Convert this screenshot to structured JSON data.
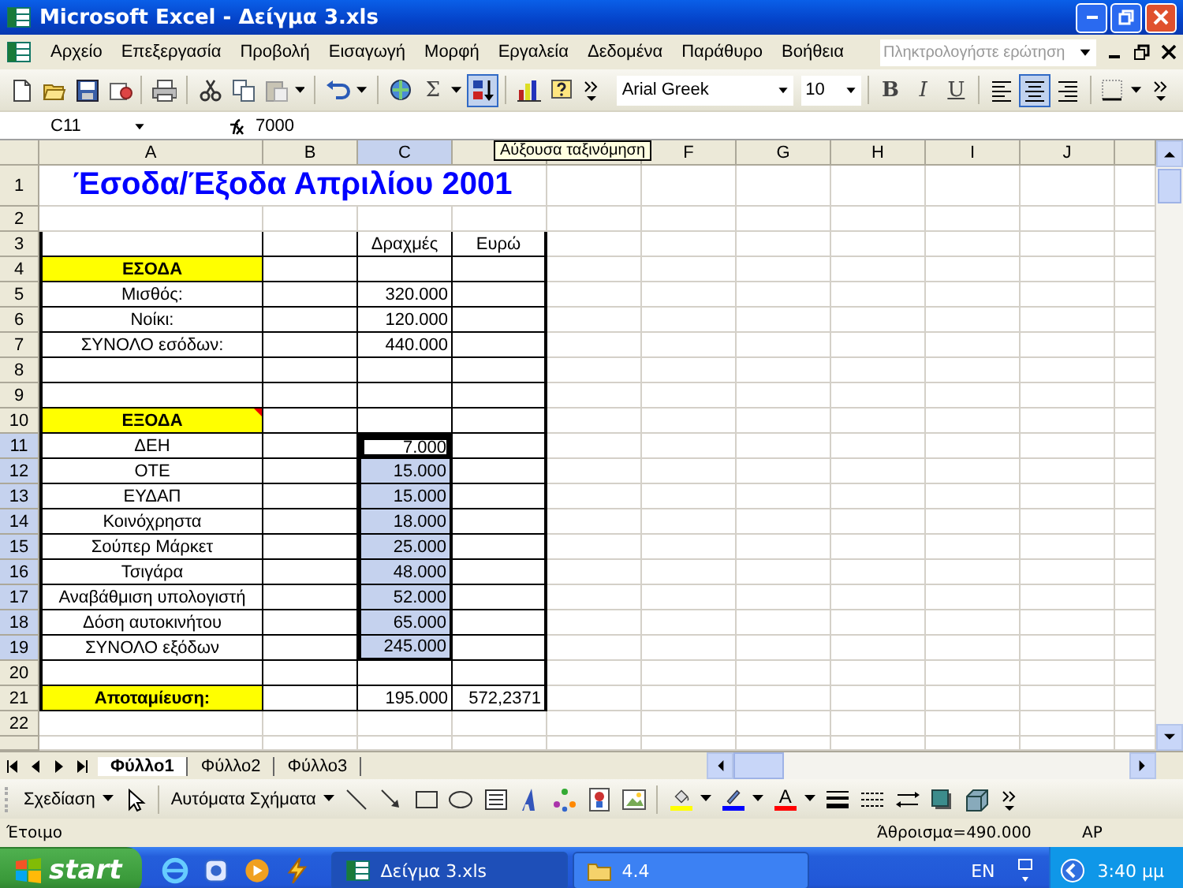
{
  "window": {
    "title": "Microsoft Excel - Δείγμα 3.xls"
  },
  "menu": [
    "Αρχείο",
    "Επεξεργασία",
    "Προβολή",
    "Εισαγωγή",
    "Μορφή",
    "Εργαλεία",
    "Δεδομένα",
    "Παράθυρο",
    "Βοήθεια"
  ],
  "help_box": {
    "placeholder": "Πληκτρολογήστε ερώτηση"
  },
  "standard_toolbar": [
    [
      {
        "kind": "new",
        "selected": false,
        "menu": false
      },
      {
        "kind": "open",
        "selected": false,
        "menu": false
      },
      {
        "kind": "save",
        "selected": false,
        "menu": false
      },
      {
        "kind": "permission",
        "selected": false,
        "menu": false
      }
    ],
    [
      {
        "kind": "print",
        "selected": false,
        "menu": false
      }
    ],
    [
      {
        "kind": "cut",
        "selected": false,
        "menu": false
      },
      {
        "kind": "copy",
        "selected": false,
        "menu": false
      },
      {
        "kind": "paste",
        "selected": false,
        "menu": true
      }
    ],
    [
      {
        "kind": "undo",
        "selected": false,
        "menu": true
      }
    ],
    [
      {
        "kind": "hyperlink",
        "selected": false,
        "menu": false
      },
      {
        "kind": "sum",
        "label": "Σ",
        "selected": false,
        "menu": true
      },
      {
        "kind": "sort",
        "selected": true,
        "menu": false
      }
    ],
    [
      {
        "kind": "chart",
        "selected": false,
        "menu": false
      },
      {
        "kind": "help",
        "selected": false,
        "menu": false
      },
      {
        "kind": "overflow",
        "selected": false,
        "menu": false
      }
    ]
  ],
  "font": {
    "value": "Arial Greek"
  },
  "size": {
    "value": "10"
  },
  "format_toolbar": [
    [
      {
        "kind": "bold",
        "label": "B",
        "selected": false,
        "menu": false
      },
      {
        "kind": "italic",
        "label": "I",
        "selected": false,
        "menu": false
      },
      {
        "kind": "underline",
        "label": "U",
        "selected": false,
        "menu": false
      }
    ],
    [
      {
        "kind": "align-left",
        "selected": false,
        "menu": false
      },
      {
        "kind": "align-center",
        "selected": true,
        "menu": false
      },
      {
        "kind": "align-right",
        "selected": false,
        "menu": false
      }
    ],
    [
      {
        "kind": "borders",
        "selected": false,
        "menu": true
      },
      {
        "kind": "overflow",
        "selected": false,
        "menu": false
      }
    ]
  ],
  "formula_bar": {
    "name_box": "C11",
    "formula": "7000"
  },
  "tooltip": "Αύξουσα ταξινόμηση",
  "columns": [
    {
      "label": "A",
      "selected": false
    },
    {
      "label": "B",
      "selected": false
    },
    {
      "label": "C",
      "selected": true
    },
    {
      "selected": false
    },
    {
      "selected": false
    },
    {
      "label": "F",
      "selected": false
    },
    {
      "label": "G",
      "selected": false
    },
    {
      "label": "H",
      "selected": false
    },
    {
      "label": "I",
      "selected": false
    },
    {
      "label": "J",
      "selected": false
    }
  ],
  "rows": [
    {
      "number": "1",
      "kind": "title",
      "selected": false,
      "cells": {
        "A": "Έσοδα/Έξοδα Απριλίου 2001"
      }
    },
    {
      "number": "2",
      "kind": "blank",
      "selected": false,
      "cells": {}
    },
    {
      "number": "3",
      "kind": "heading",
      "selected": false,
      "cells": {
        "C": "Δραχμές",
        "D": "Ευρώ"
      }
    },
    {
      "number": "4",
      "kind": "section",
      "selected": false,
      "cells": {
        "A": "ΕΣΟΔΑ"
      }
    },
    {
      "number": "5",
      "kind": "plain",
      "selected": false,
      "cells": {
        "A": "Μισθός:",
        "C": "320.000"
      }
    },
    {
      "number": "6",
      "kind": "plain",
      "selected": false,
      "cells": {
        "A": "Νοίκι:",
        "C": "120.000"
      }
    },
    {
      "number": "7",
      "kind": "plain",
      "selected": false,
      "cells": {
        "A": "ΣΥΝΟΛΟ εσόδων:",
        "C": "440.000"
      }
    },
    {
      "number": "8",
      "kind": "plain",
      "selected": false,
      "cells": {}
    },
    {
      "number": "9",
      "kind": "plain",
      "selected": false,
      "cells": {}
    },
    {
      "number": "10",
      "kind": "section",
      "selected": false,
      "comment": true,
      "cells": {
        "A": "ΕΞΟΔΑ"
      }
    },
    {
      "number": "11",
      "kind": "plain",
      "selected": true,
      "cells": {
        "A": "ΔΕΗ",
        "C": "7.000"
      }
    },
    {
      "number": "12",
      "kind": "plain",
      "selected": true,
      "cells": {
        "A": "ΟΤΕ",
        "C": "15.000"
      }
    },
    {
      "number": "13",
      "kind": "plain",
      "selected": true,
      "cells": {
        "A": "ΕΥΔΑΠ",
        "C": "15.000"
      }
    },
    {
      "number": "14",
      "kind": "plain",
      "selected": true,
      "cells": {
        "A": "Κοινόχρηστα",
        "C": "18.000"
      }
    },
    {
      "number": "15",
      "kind": "plain",
      "selected": true,
      "cells": {
        "A": "Σούπερ Μάρκετ",
        "C": "25.000"
      }
    },
    {
      "number": "16",
      "kind": "plain",
      "selected": true,
      "cells": {
        "A": "Τσιγάρα",
        "C": "48.000"
      }
    },
    {
      "number": "17",
      "kind": "plain",
      "selected": true,
      "cells": {
        "A": "Αναβάθμιση υπολογιστή",
        "C": "52.000"
      }
    },
    {
      "number": "18",
      "kind": "plain",
      "selected": true,
      "cells": {
        "A": "Δόση αυτοκινήτου",
        "C": "65.000"
      }
    },
    {
      "number": "19",
      "kind": "plain",
      "selected": true,
      "cells": {
        "A": "ΣΥΝΟΛΟ εξόδων",
        "C": "245.000"
      }
    },
    {
      "number": "20",
      "kind": "plain",
      "selected": false,
      "cells": {}
    },
    {
      "number": "21",
      "kind": "section",
      "selected": false,
      "cells": {
        "A": "Αποταμίευση:",
        "C": "195.000",
        "D": "572,2371"
      }
    },
    {
      "number": "22",
      "kind": "blank",
      "selected": false,
      "cells": {}
    }
  ],
  "sheet_tabs": [
    {
      "label": "Φύλλο1",
      "selected": true
    },
    {
      "label": "Φύλλο2",
      "selected": false
    },
    {
      "label": "Φύλλο3",
      "selected": false
    }
  ],
  "drawing_toolbar": [
    {
      "kind": "text",
      "label": "Σχεδίαση",
      "menu": true
    },
    {
      "kind": "pointer",
      "menu": false
    },
    {
      "kind": "separator"
    },
    {
      "kind": "text",
      "label": "Αυτόματα Σχήματα",
      "menu": true
    },
    {
      "kind": "line",
      "menu": false
    },
    {
      "kind": "arrow",
      "menu": false
    },
    {
      "kind": "rectangle",
      "menu": false
    },
    {
      "kind": "oval",
      "menu": false
    },
    {
      "kind": "textbox",
      "menu": false
    },
    {
      "kind": "wordart",
      "menu": false
    },
    {
      "kind": "diagram",
      "menu": false
    },
    {
      "kind": "clipart",
      "menu": false
    },
    {
      "kind": "image",
      "menu": false
    },
    {
      "kind": "separator"
    },
    {
      "kind": "fill",
      "color": "#ffff00",
      "menu": true
    },
    {
      "kind": "pen",
      "color": "#0000ff",
      "menu": true
    },
    {
      "kind": "letter",
      "label": "A",
      "color": "#ff0000",
      "menu": true
    },
    {
      "kind": "linestyle",
      "menu": false
    },
    {
      "kind": "dashstyle",
      "menu": false
    },
    {
      "kind": "arrowstyle",
      "menu": false
    },
    {
      "kind": "shadow",
      "menu": false
    },
    {
      "kind": "cube",
      "menu": false
    },
    {
      "kind": "overflow",
      "menu": false
    }
  ],
  "status_bar": {
    "state": "Έτοιμο",
    "sum": "Άθροισμα=490.000",
    "mode": "ΑΡ"
  },
  "taskbar": {
    "start": "start",
    "quick_launch": [
      {
        "kind": "browser"
      },
      {
        "kind": "mediacenter"
      },
      {
        "kind": "player"
      },
      {
        "kind": "lightning"
      }
    ],
    "tasks": [
      {
        "label": "Δείγμα 3.xls",
        "kind": "spreadsheet",
        "selected": true
      },
      {
        "label": "4.4",
        "kind": "folder",
        "selected": false
      }
    ],
    "language": "EN",
    "clock": "3:40 μμ"
  }
}
